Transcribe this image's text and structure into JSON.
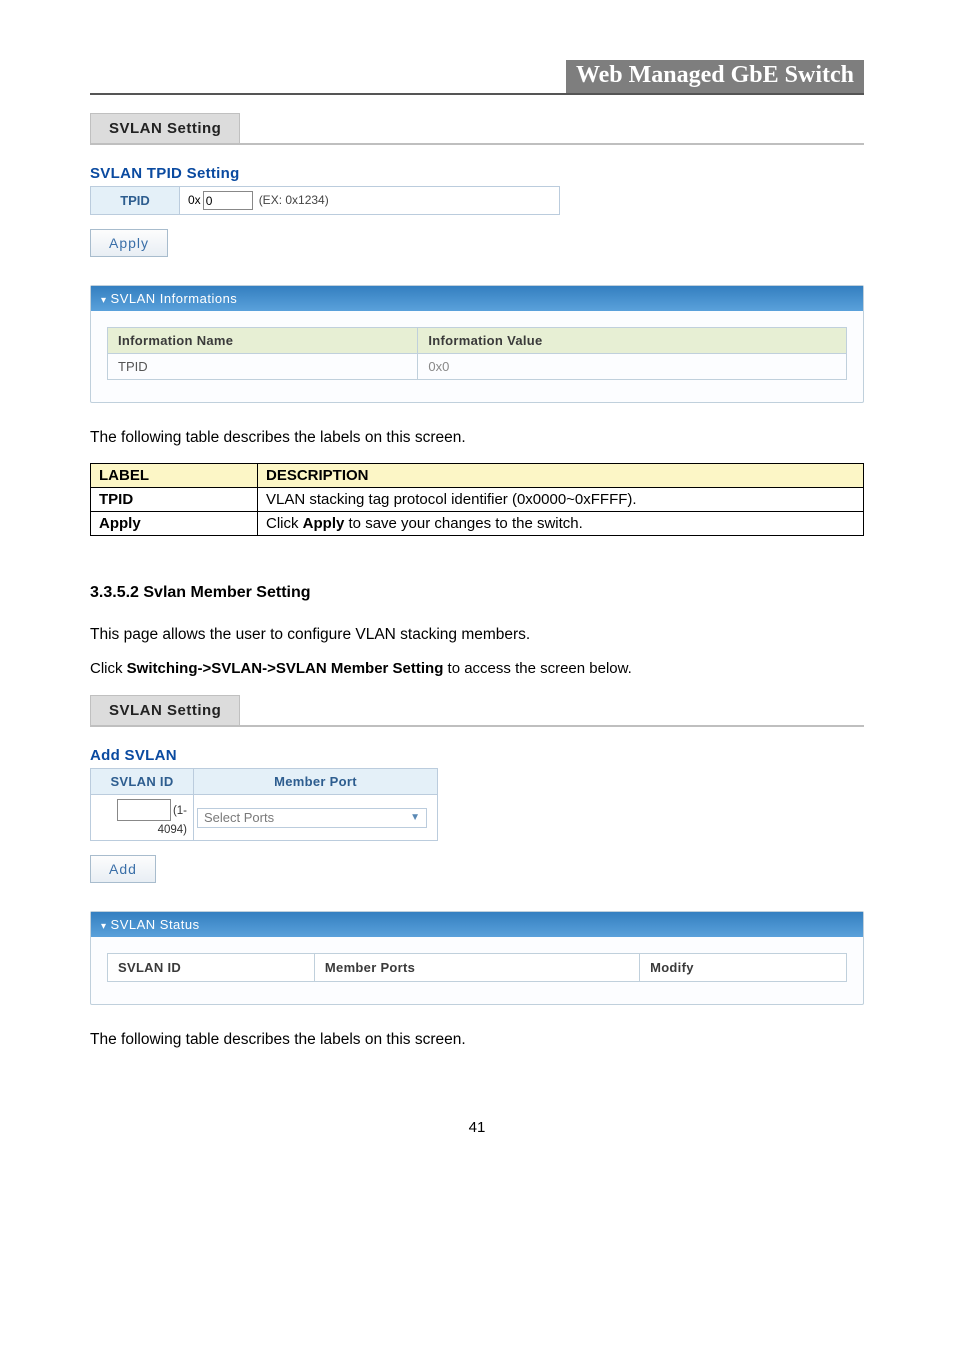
{
  "header": {
    "title": "Web Managed GbE Switch"
  },
  "tpid_section": {
    "tab_label": "SVLAN Setting",
    "title": "SVLAN TPID Setting",
    "row_label": "TPID",
    "prefix": "0x",
    "input_value": "0",
    "hint": "(EX: 0x1234)",
    "apply_label": "Apply"
  },
  "info_panel": {
    "header": "SVLAN Informations",
    "col_name": "Information Name",
    "col_value": "Information Value",
    "row_name": "TPID",
    "row_value": "0x0"
  },
  "desc_intro_1": "The following table describes the labels on this screen.",
  "desc_table_1": {
    "col_label": "LABEL",
    "col_desc": "DESCRIPTION",
    "rows": [
      {
        "label": "TPID",
        "desc": "VLAN stacking tag protocol identifier (0x0000~0xFFFF)."
      },
      {
        "label": "Apply",
        "desc_prefix": "Click ",
        "desc_bold": "Apply",
        "desc_suffix": " to save your changes to the switch."
      }
    ]
  },
  "subsection": {
    "heading": "3.3.5.2 Svlan Member Setting",
    "p1": "This page allows the user to configure VLAN stacking members.",
    "nav_prefix": "Click ",
    "nav_bold": "Switching->SVLAN->SVLAN Member Setting",
    "nav_suffix": " to access the screen below."
  },
  "add_section": {
    "tab_label": "SVLAN Setting",
    "title": "Add SVLAN",
    "col_id": "SVLAN ID",
    "col_port": "Member Port",
    "id_hint": "(1-4094)",
    "select_placeholder": "Select Ports",
    "add_label": "Add"
  },
  "status_panel": {
    "header": "SVLAN Status",
    "col_id": "SVLAN ID",
    "col_ports": "Member Ports",
    "col_modify": "Modify"
  },
  "desc_intro_2": "The following table describes the labels on this screen.",
  "page_number": "41"
}
